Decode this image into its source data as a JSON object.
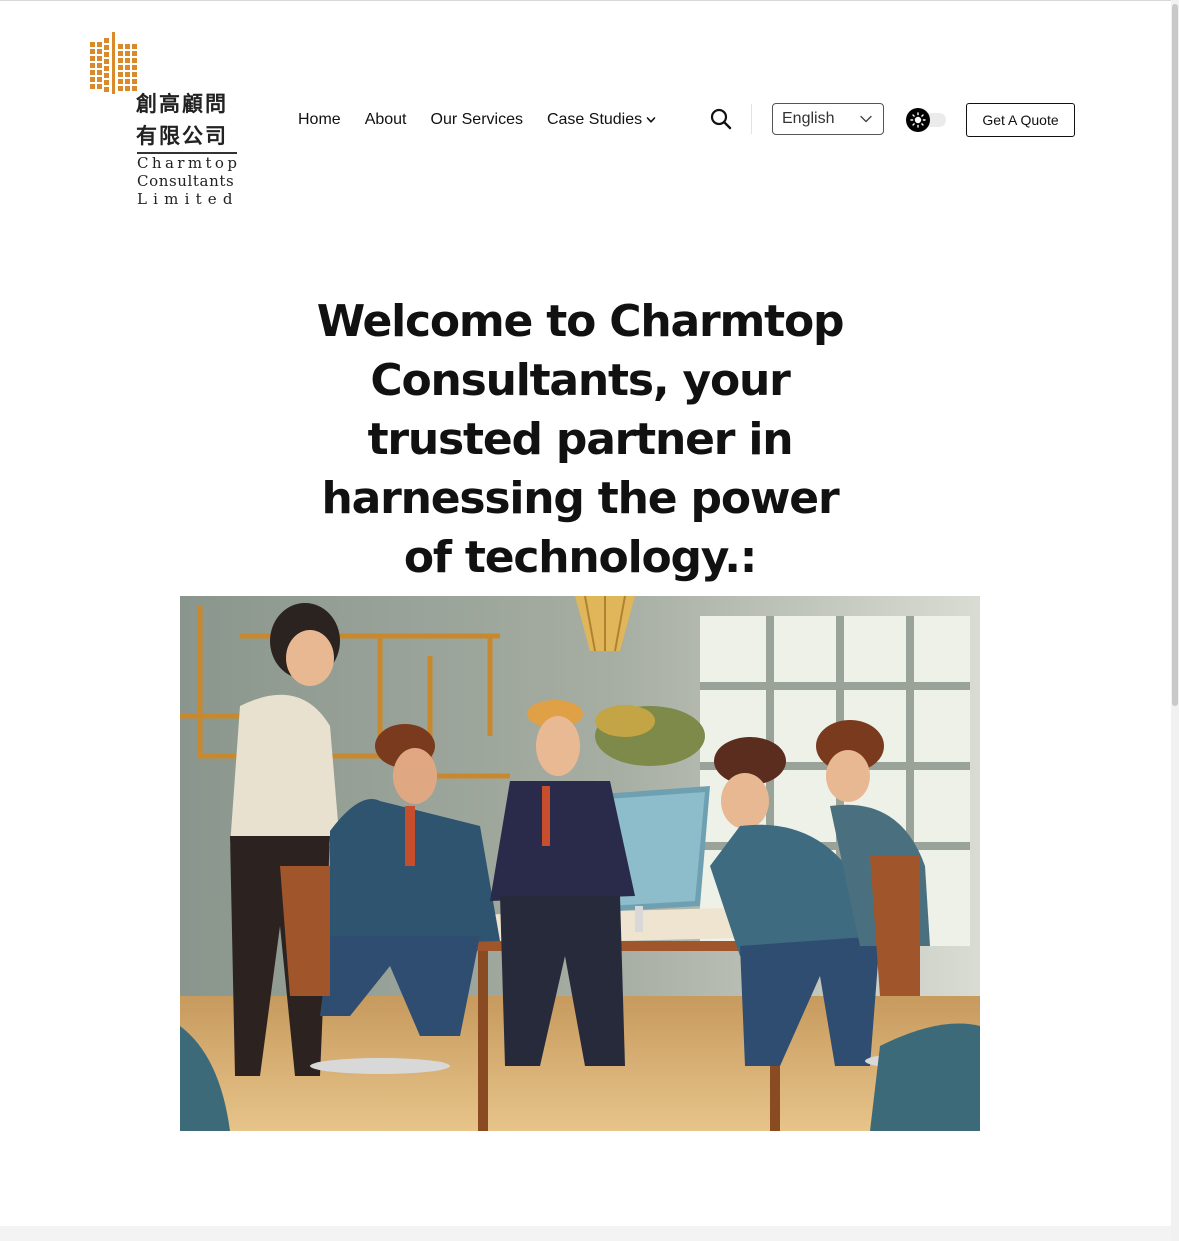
{
  "brand": {
    "name_cjk_line1": "創高顧問",
    "name_cjk_line2": "有限公司",
    "name_en_line1": "Charmtop",
    "name_en_line2": "Consultants",
    "name_en_line3": "Limited",
    "logo_color": "#d98a2b"
  },
  "nav": {
    "items": [
      {
        "label": "Home"
      },
      {
        "label": "About"
      },
      {
        "label": "Our Services"
      },
      {
        "label": "Case Studies",
        "icon": "chevron-down-icon"
      }
    ]
  },
  "header": {
    "search_icon": "search-icon",
    "language": {
      "selected": "English",
      "icon": "chevron-down-icon"
    },
    "theme_toggle_icon": "sun-icon",
    "quote_button_label": "Get A Quote"
  },
  "hero": {
    "title": "Welcome to Charmtop Consultants, your trusted partner in harnessing the power of technology.:",
    "image_description": "illustration-team-meeting"
  }
}
